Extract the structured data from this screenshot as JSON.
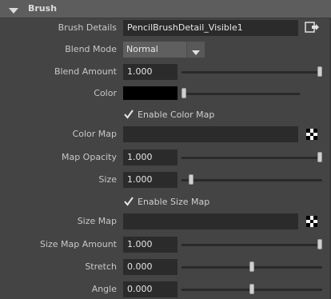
{
  "section": {
    "title": "Brush",
    "expanded": true
  },
  "fields": {
    "brush_details": {
      "label": "Brush Details",
      "value": "PencilBrushDetail_Visible1",
      "icon": "connect-icon"
    },
    "blend_mode": {
      "label": "Blend Mode",
      "value": "Normal"
    },
    "blend_amount": {
      "label": "Blend Amount",
      "value": "1.000",
      "slider": 1.0
    },
    "color": {
      "label": "Color",
      "value": "#000000",
      "slider": 0.0
    },
    "enable_color_map": {
      "label": "Enable Color Map",
      "checked": true
    },
    "color_map": {
      "label": "Color Map",
      "value": "",
      "icon": "checker-map-icon"
    },
    "map_opacity": {
      "label": "Map Opacity",
      "value": "1.000",
      "slider": 1.0
    },
    "size": {
      "label": "Size",
      "value": "1.000",
      "slider": 0.0
    },
    "enable_size_map": {
      "label": "Enable Size Map",
      "checked": true
    },
    "size_map": {
      "label": "Size Map",
      "value": "",
      "icon": "checker-map-icon"
    },
    "size_map_amount": {
      "label": "Size Map Amount",
      "value": "1.000",
      "slider": 1.0
    },
    "stretch": {
      "label": "Stretch",
      "value": "0.000",
      "slider": 0.5
    },
    "angle": {
      "label": "Angle",
      "value": "0.000",
      "slider": 0.5
    }
  },
  "colors": {
    "background": "#444444",
    "field": "#2b2b2b",
    "header": "#5d5d5d",
    "text": "#cfcfcf"
  }
}
